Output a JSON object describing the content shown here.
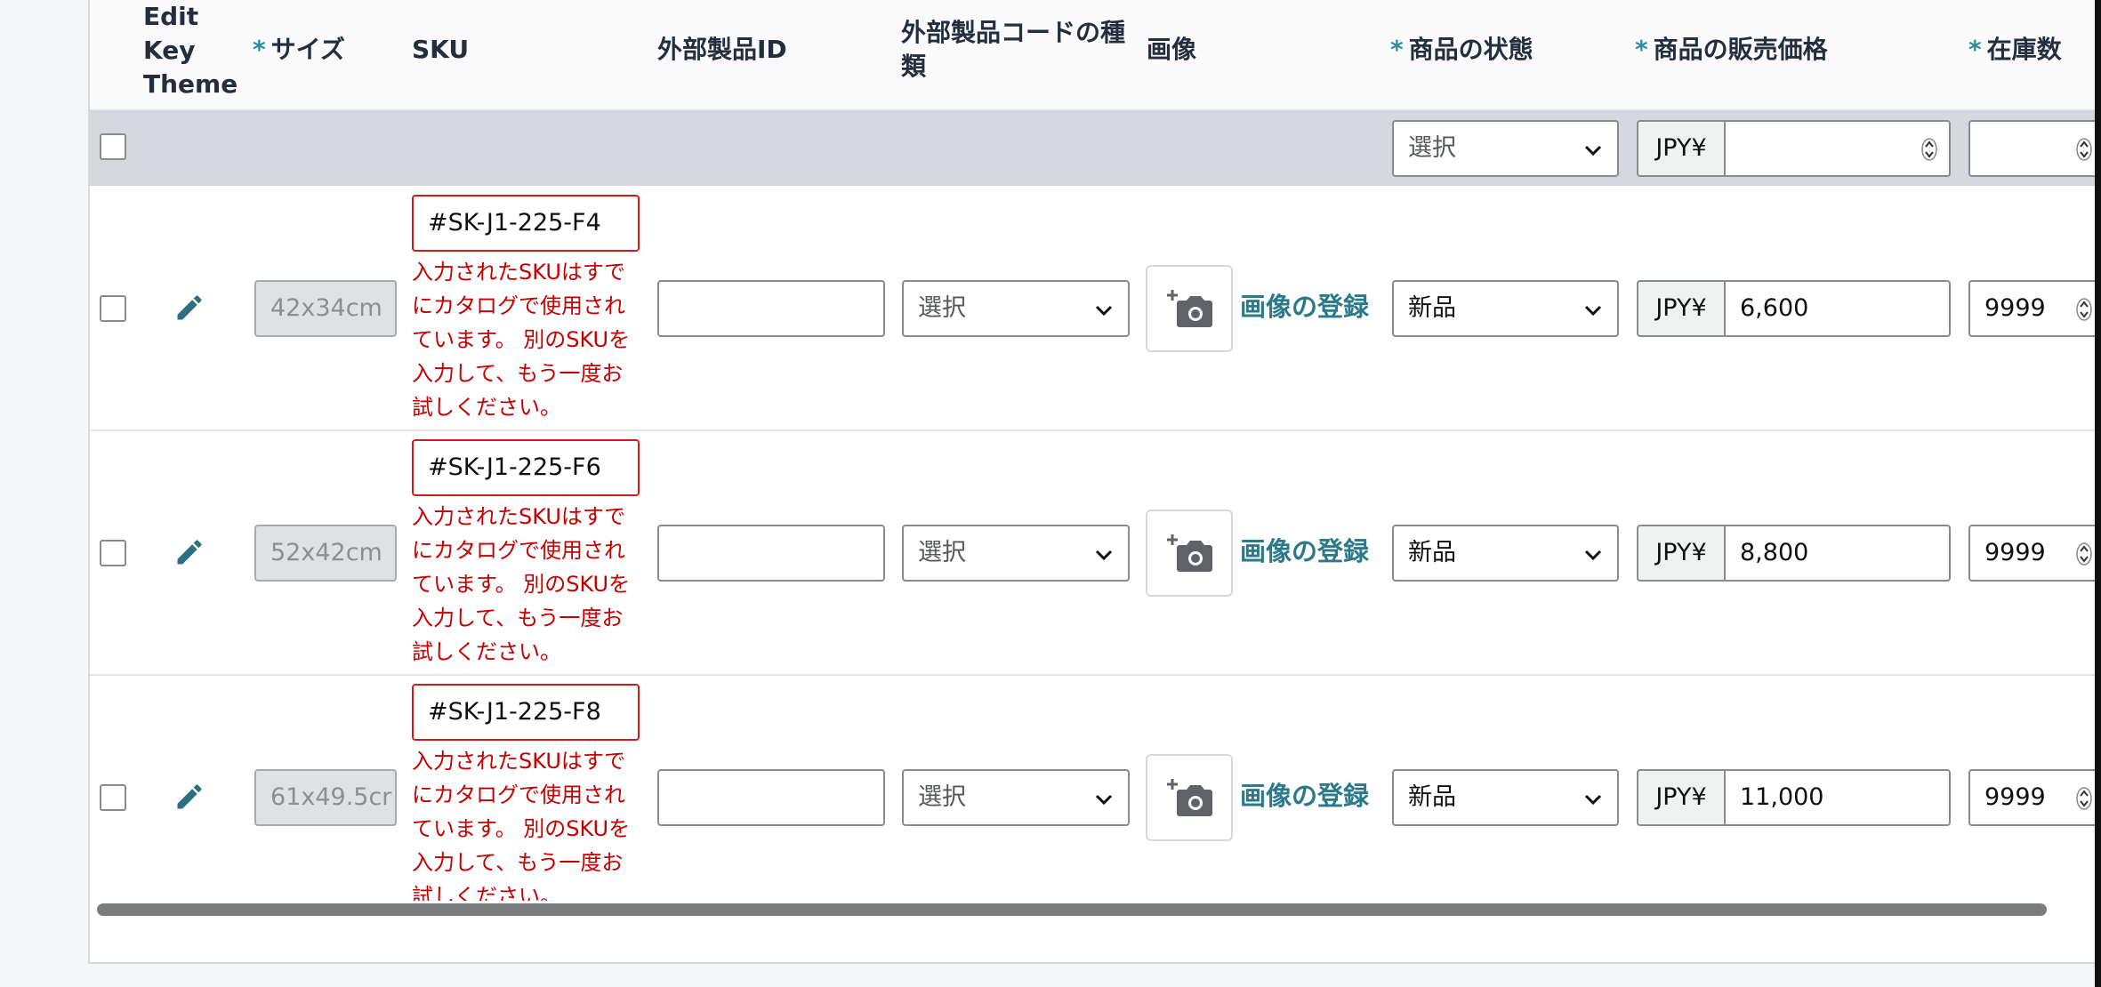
{
  "headers": {
    "edit_key_theme": [
      "Edit",
      "Key",
      "Theme"
    ],
    "required_mark": "*",
    "size": "サイズ",
    "sku": "SKU",
    "external_product_id": "外部製品ID",
    "external_code_type": [
      "外部製品コードの種",
      "類"
    ],
    "image": "画像",
    "condition": "商品の状態",
    "price": "商品の販売価格",
    "stock": "在庫数"
  },
  "bulk_row": {
    "condition_placeholder": "選択",
    "currency": "JPY¥",
    "price": "",
    "stock": ""
  },
  "rows": [
    {
      "size": "42x34cm",
      "sku": "#SK-J1-225-F4",
      "sku_error": [
        "入力されたSKUはすで",
        "にカタログで使用され",
        "ています。 別のSKUを",
        "入力して、もう一度お",
        "試しください。"
      ],
      "external_id": "",
      "code_type": "選択",
      "image_link": "画像の登録",
      "condition": "新品",
      "currency": "JPY¥",
      "price": "6,600",
      "stock": "9999"
    },
    {
      "size": "52x42cm",
      "sku": "#SK-J1-225-F6",
      "sku_error": [
        "入力されたSKUはすで",
        "にカタログで使用され",
        "ています。 別のSKUを",
        "入力して、もう一度お",
        "試しください。"
      ],
      "external_id": "",
      "code_type": "選択",
      "image_link": "画像の登録",
      "condition": "新品",
      "currency": "JPY¥",
      "price": "8,800",
      "stock": "9999"
    },
    {
      "size": "61x49.5cr",
      "sku": "#SK-J1-225-F8",
      "sku_error": [
        "入力されたSKUはすで",
        "にカタログで使用され",
        "ています。 別のSKUを",
        "入力して、もう一度お",
        "試しください。"
      ],
      "external_id": "",
      "code_type": "選択",
      "image_link": "画像の登録",
      "condition": "新品",
      "currency": "JPY¥",
      "price": "11,000",
      "stock": "9999"
    }
  ],
  "icons": {
    "edit": "pencil-icon",
    "image": "add-photo-icon",
    "dropdown": "chevron-down-icon",
    "spinner": "spinner-arrows-icon"
  },
  "colors": {
    "error": "#c40000",
    "error_border": "#cc1c1c",
    "link": "#2b7a8c",
    "required": "#2e8c9e"
  }
}
